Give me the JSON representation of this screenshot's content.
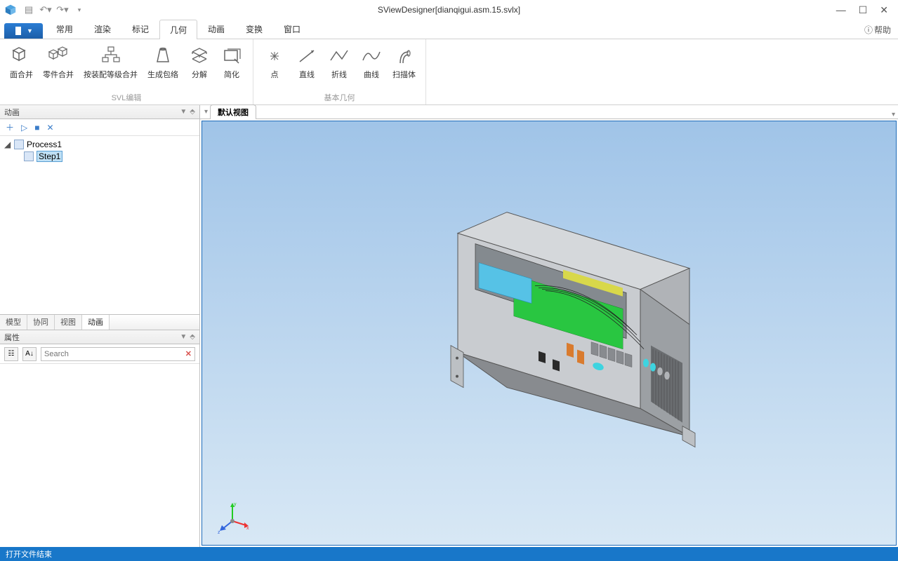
{
  "title": "SViewDesigner[dianqigui.asm.15.svlx]",
  "help_label": "帮助",
  "menu_tabs": {
    "file": "",
    "items": [
      "常用",
      "渲染",
      "标记",
      "几何",
      "动画",
      "变换",
      "窗口"
    ],
    "active": "几何"
  },
  "ribbon": {
    "group1": {
      "label": "SVL编辑",
      "items": [
        "面合并",
        "零件合并",
        "按装配等级合并",
        "生成包络",
        "分解",
        "简化"
      ]
    },
    "group2": {
      "label": "基本几何",
      "items": [
        "点",
        "直线",
        "折线",
        "曲线",
        "扫描体"
      ]
    }
  },
  "left_panel": {
    "header": "动画",
    "toolbar_icons": [
      "＋",
      "▷",
      "■",
      "✕"
    ],
    "tree": {
      "root": "Process1",
      "child": "Step1"
    },
    "tabs": [
      "模型",
      "协同",
      "视图",
      "动画"
    ],
    "active_tab": "动画"
  },
  "properties": {
    "header": "属性",
    "search_placeholder": "Search"
  },
  "viewport": {
    "tab": "默认视图",
    "axes": [
      "x",
      "y",
      "z"
    ]
  },
  "statusbar": "打开文件结束"
}
